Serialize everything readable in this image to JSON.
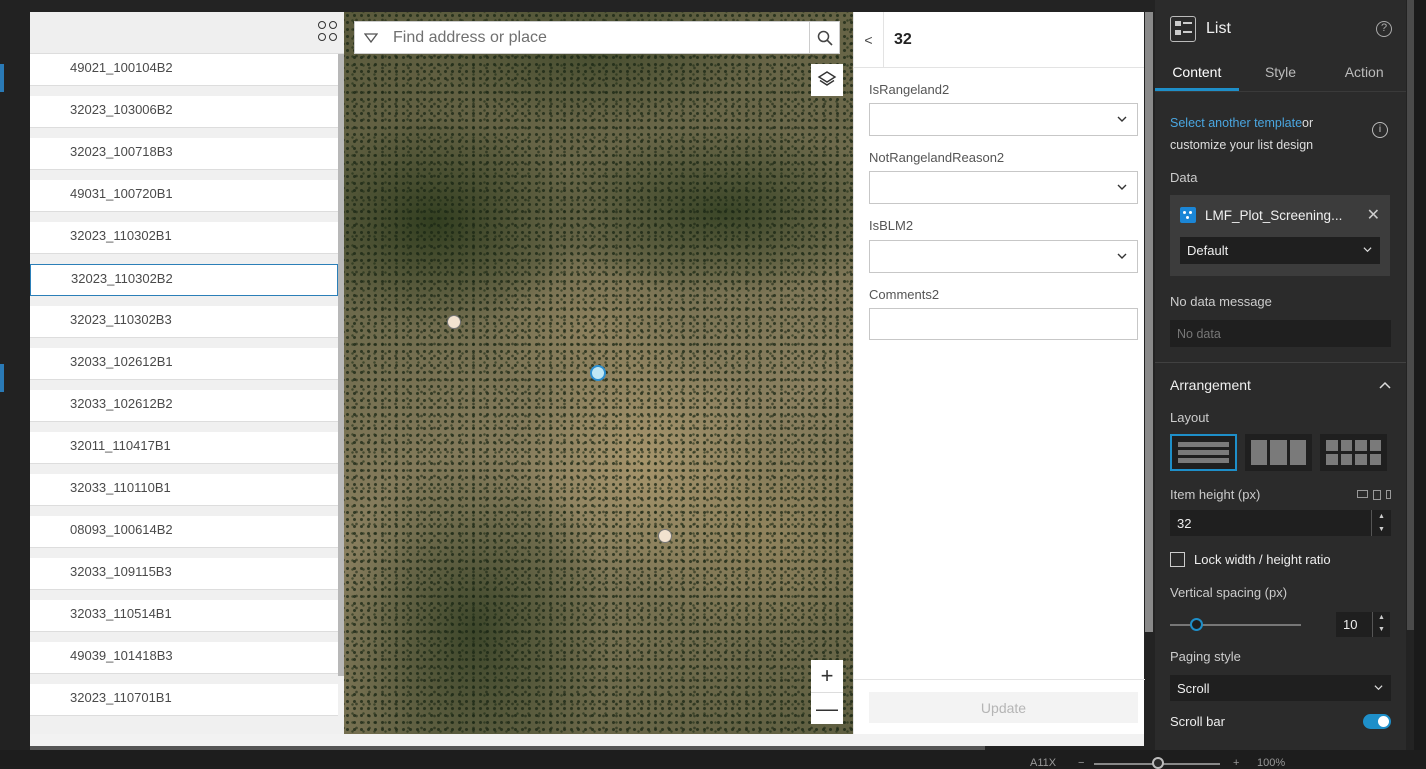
{
  "list": {
    "items": [
      "49021_100104B2",
      "32023_103006B2",
      "32023_100718B3",
      "49031_100720B1",
      "32023_110302B1",
      "32023_110302B2",
      "32023_110302B3",
      "32033_102612B1",
      "32033_102612B2",
      "32011_110417B1",
      "32033_110110B1",
      "08093_100614B2",
      "32033_109115B3",
      "32033_110514B1",
      "49039_101418B3",
      "32023_110701B1"
    ],
    "selected_index": 5
  },
  "map": {
    "search_placeholder": "Find address or place",
    "zoom_in": "+",
    "zoom_out": "—"
  },
  "form": {
    "back": "<",
    "title": "32",
    "fields": [
      {
        "label": "IsRangeland2"
      },
      {
        "label": "NotRangelandReason2"
      },
      {
        "label": "IsBLM2"
      },
      {
        "label": "Comments2"
      }
    ],
    "update_label": "Update"
  },
  "panel": {
    "title": "List",
    "tabs": [
      "Content",
      "Style",
      "Action"
    ],
    "active_tab": "Content",
    "hint_link": "Select another template",
    "hint_text_1": "or",
    "hint_text_2": "customize your list design",
    "data_label": "Data",
    "data_source": "LMF_Plot_Screening...",
    "data_view": "Default",
    "no_data_label": "No data message",
    "no_data_placeholder": "No data",
    "arrangement_title": "Arrangement",
    "layout_label": "Layout",
    "item_height_label": "Item height (px)",
    "item_height_value": "32",
    "lock_ratio_label": "Lock width / height ratio",
    "vertical_spacing_label": "Vertical spacing (px)",
    "vertical_spacing_value": "10",
    "vertical_spacing_fraction": 0.2,
    "paging_label": "Paging style",
    "paging_value": "Scroll",
    "scrollbar_label": "Scroll bar",
    "scrollbar_on": true
  },
  "status": {
    "zoom_level": "100%",
    "left_text": "A11X"
  },
  "colors": {
    "accent": "#1e8fc9",
    "selected_point": "#2c8ecf",
    "point": "#f2e2cf"
  }
}
